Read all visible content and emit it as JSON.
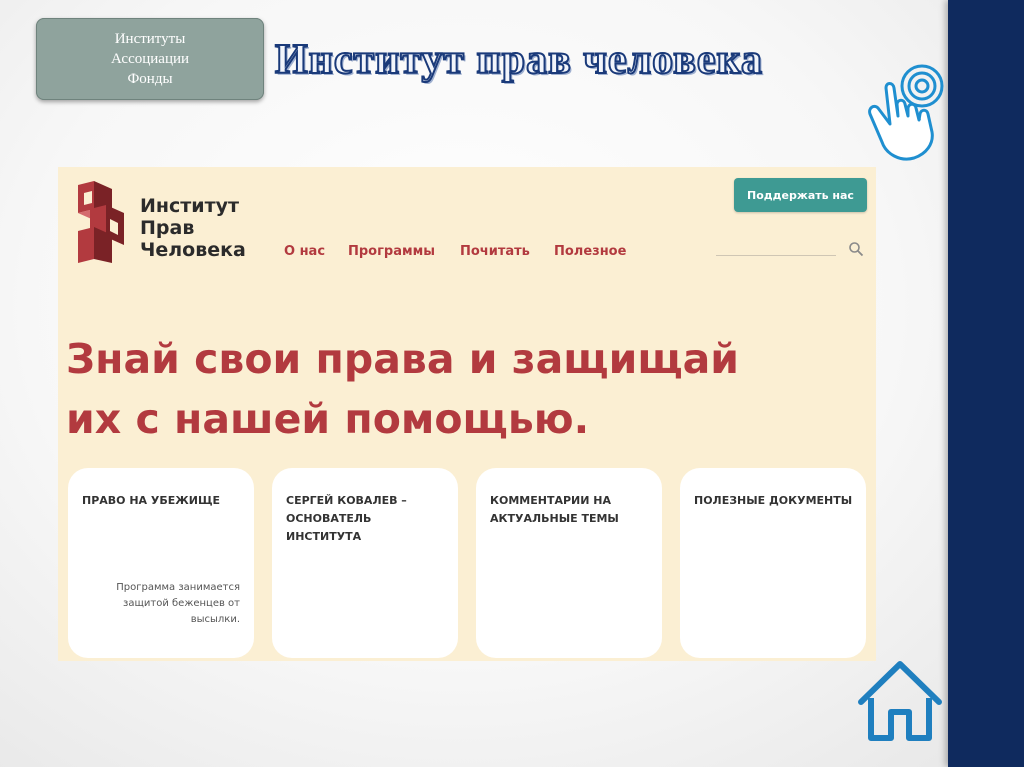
{
  "slide": {
    "nav_box_lines": [
      "Институты",
      "Ассоциации",
      "Фонды"
    ],
    "title": "Институт прав человека"
  },
  "website": {
    "logo_lines": [
      "Институт",
      "Прав",
      "Человека"
    ],
    "nav": [
      "О нас",
      "Программы",
      "Почитать",
      "Полезное"
    ],
    "donate_label": "Поддержать нас",
    "headline_lines": [
      "Знай свои права и защищай",
      "их с нашей помощью."
    ],
    "cards": [
      {
        "title": "Право на убежище",
        "desc": "Программа занимается защитой беженцев от высылки."
      },
      {
        "title": "Сергей Ковалев – основатель института",
        "desc": ""
      },
      {
        "title": "Комментарии на актуальные темы",
        "desc": ""
      },
      {
        "title": "Полезные документы",
        "desc": ""
      }
    ]
  },
  "icons": {
    "pointer": "hand-pointer-icon",
    "home": "home-icon",
    "search": "search-icon",
    "logo": "logo-icon"
  },
  "colors": {
    "accent_red": "#b23a3f",
    "button_teal": "#3e9a93",
    "panel_bg": "#fbefd3",
    "side_band": "#0f2a5e"
  }
}
